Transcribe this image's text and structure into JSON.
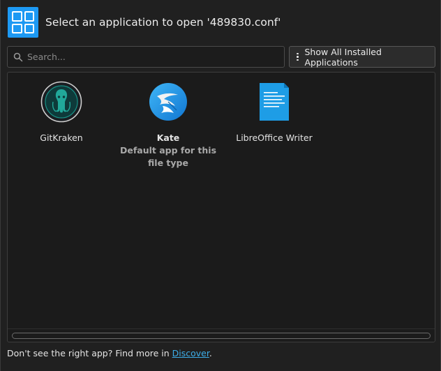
{
  "window": {
    "title": "Select an application to open '489830.conf'",
    "icon": "app-grid-icon"
  },
  "search": {
    "placeholder": "Search...",
    "value": "",
    "icon": "search-icon"
  },
  "show_all_button": {
    "label": "Show All Installed Applications",
    "icon": "kebab-menu-icon"
  },
  "apps": [
    {
      "name": "GitKraken",
      "subtitle": "",
      "icon": "gitkraken-icon"
    },
    {
      "name": "Kate",
      "subtitle": "Default app for this file type",
      "icon": "kate-icon",
      "is_default": true
    },
    {
      "name": "LibreOffice Writer",
      "subtitle": "",
      "icon": "libreoffice-writer-icon"
    }
  ],
  "footer": {
    "text": "Don't see the right app? Find more in ",
    "link": "Discover",
    "suffix": "."
  },
  "colors": {
    "accent": "#1d99f3",
    "link": "#3daee9",
    "background": "#202020"
  }
}
